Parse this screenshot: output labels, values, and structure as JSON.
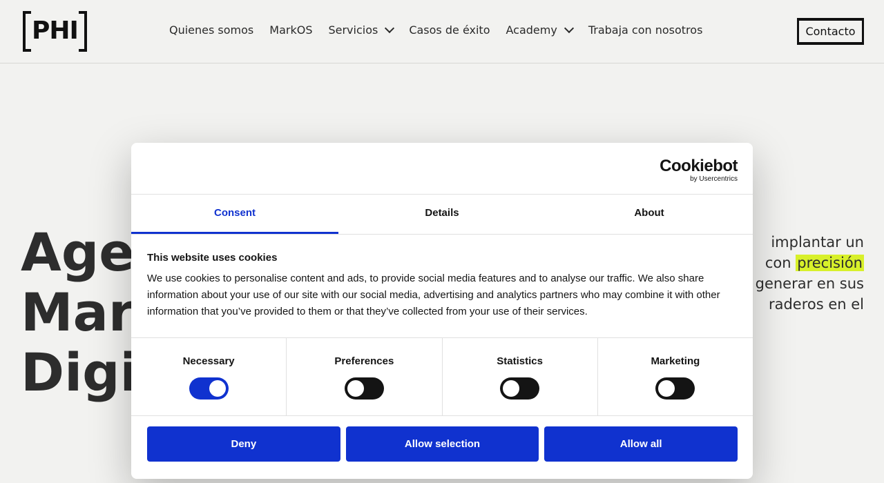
{
  "header": {
    "logo_text": "PHI",
    "nav": [
      {
        "label": "Quienes somos",
        "has_dropdown": false
      },
      {
        "label": "MarkOS",
        "has_dropdown": false
      },
      {
        "label": "Servicios",
        "has_dropdown": true
      },
      {
        "label": "Casos de éxito",
        "has_dropdown": false
      },
      {
        "label": "Academy",
        "has_dropdown": true
      },
      {
        "label": "Trabaja con nosotros",
        "has_dropdown": false
      }
    ],
    "contact_label": "Contacto"
  },
  "hero": {
    "title_lines": [
      "Agen",
      "Mark",
      "Digit"
    ],
    "text_lines": [
      "implantar un",
      "con",
      "precisión",
      "generar en sus",
      "raderos en el"
    ],
    "highlight_color": "#d8f02a"
  },
  "cookie_dialog": {
    "brand": "Cookiebot",
    "brand_sub": "by Usercentrics",
    "tabs": [
      "Consent",
      "Details",
      "About"
    ],
    "active_tab": "Consent",
    "heading": "This website uses cookies",
    "body": "We use cookies to personalise content and ads, to provide social media features and to analyse our traffic. We also share information about your use of our site with our social media, advertising and analytics partners who may combine it with other information that you’ve provided to them or that they’ve collected from your use of their services.",
    "categories": [
      {
        "label": "Necessary",
        "enabled": true
      },
      {
        "label": "Preferences",
        "enabled": false
      },
      {
        "label": "Statistics",
        "enabled": false
      },
      {
        "label": "Marketing",
        "enabled": false
      }
    ],
    "buttons": {
      "deny": "Deny",
      "allow_selection": "Allow selection",
      "allow_all": "Allow all"
    },
    "accent_color": "#1032cf"
  }
}
